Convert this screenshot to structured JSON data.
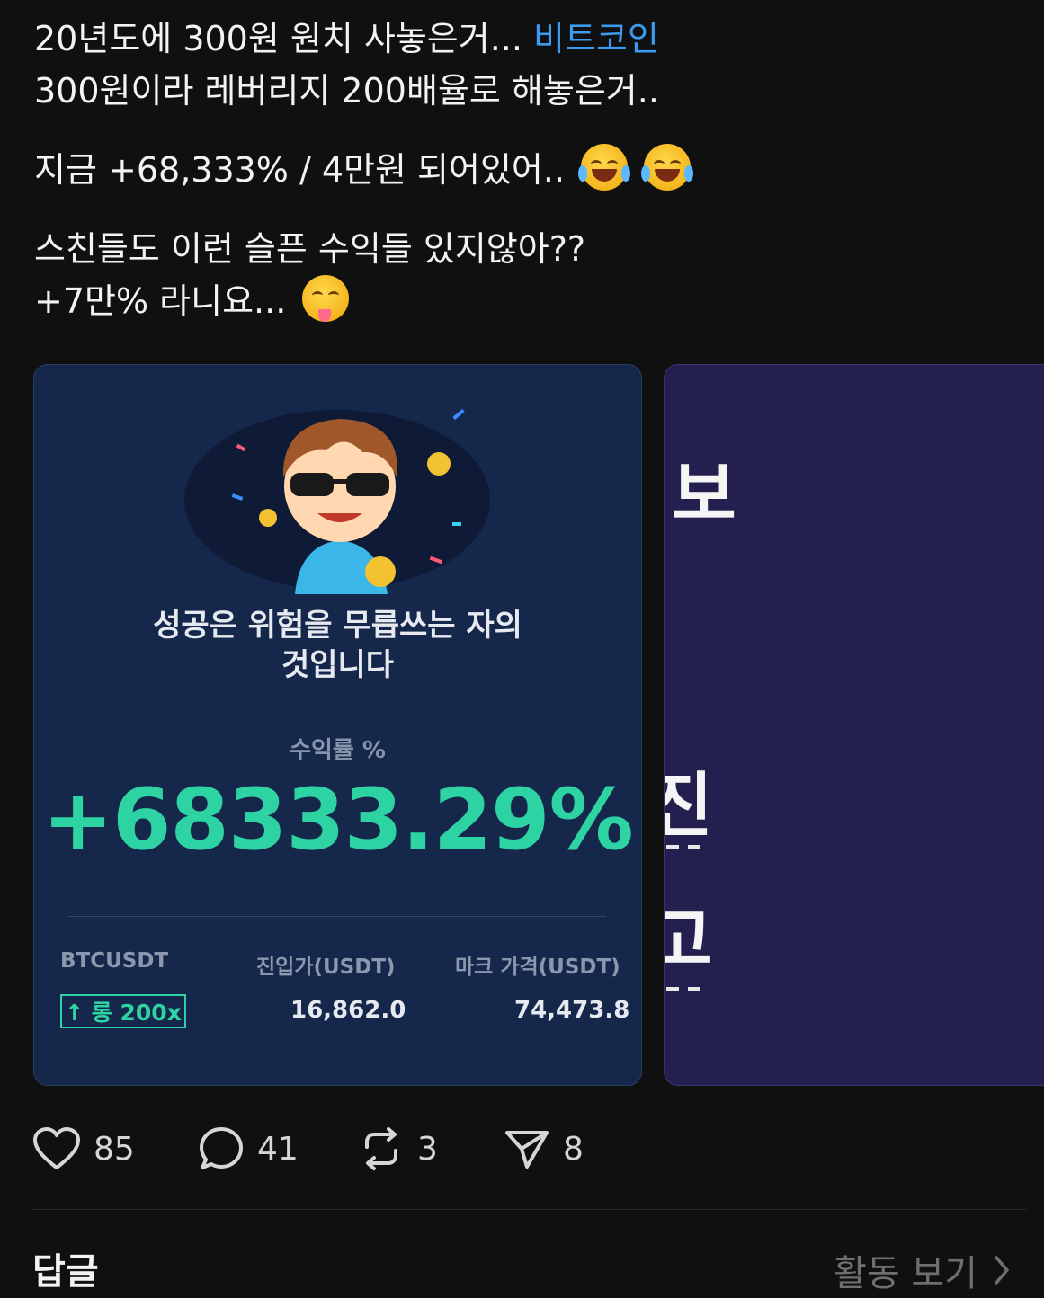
{
  "post": {
    "line1_text": "20년도에 300원 원치 사놓은거... ",
    "line1_hashtag": "비트코인",
    "line2": "300원이라 레버리지 200배율로 해놓은거..",
    "line3": "지금 +68,333% / 4만원 되어있어..",
    "line3_emojis": [
      "face-with-tears-of-joy",
      "face-with-tears-of-joy"
    ],
    "line4": "스친들도 이런 슬픈 수익들 있지않아??",
    "line5": "+7만% 라니요...",
    "line5_emoji": "zany-face"
  },
  "card1": {
    "quote_line1": "성공은 위험을 무릅쓰는 자의",
    "quote_line2": "것입니다",
    "roi_label": "수익률 %",
    "roi_value": "+68333.29%",
    "symbol": "BTCUSDT",
    "position_badge": "↑ 롱 200x",
    "entry_label": "진입가(USDT)",
    "entry_value": "16,862.0",
    "mark_label": "마크 가격(USDT)",
    "mark_value": "74,473.8",
    "accent_color": "#2ed3a3"
  },
  "card2": {
    "char1": "보",
    "char2": "진",
    "char3": "고"
  },
  "actions": {
    "likes": "85",
    "comments": "41",
    "reposts": "3",
    "shares": "8"
  },
  "footer": {
    "replies_label": "답글",
    "activity_label": "활동 보기"
  }
}
